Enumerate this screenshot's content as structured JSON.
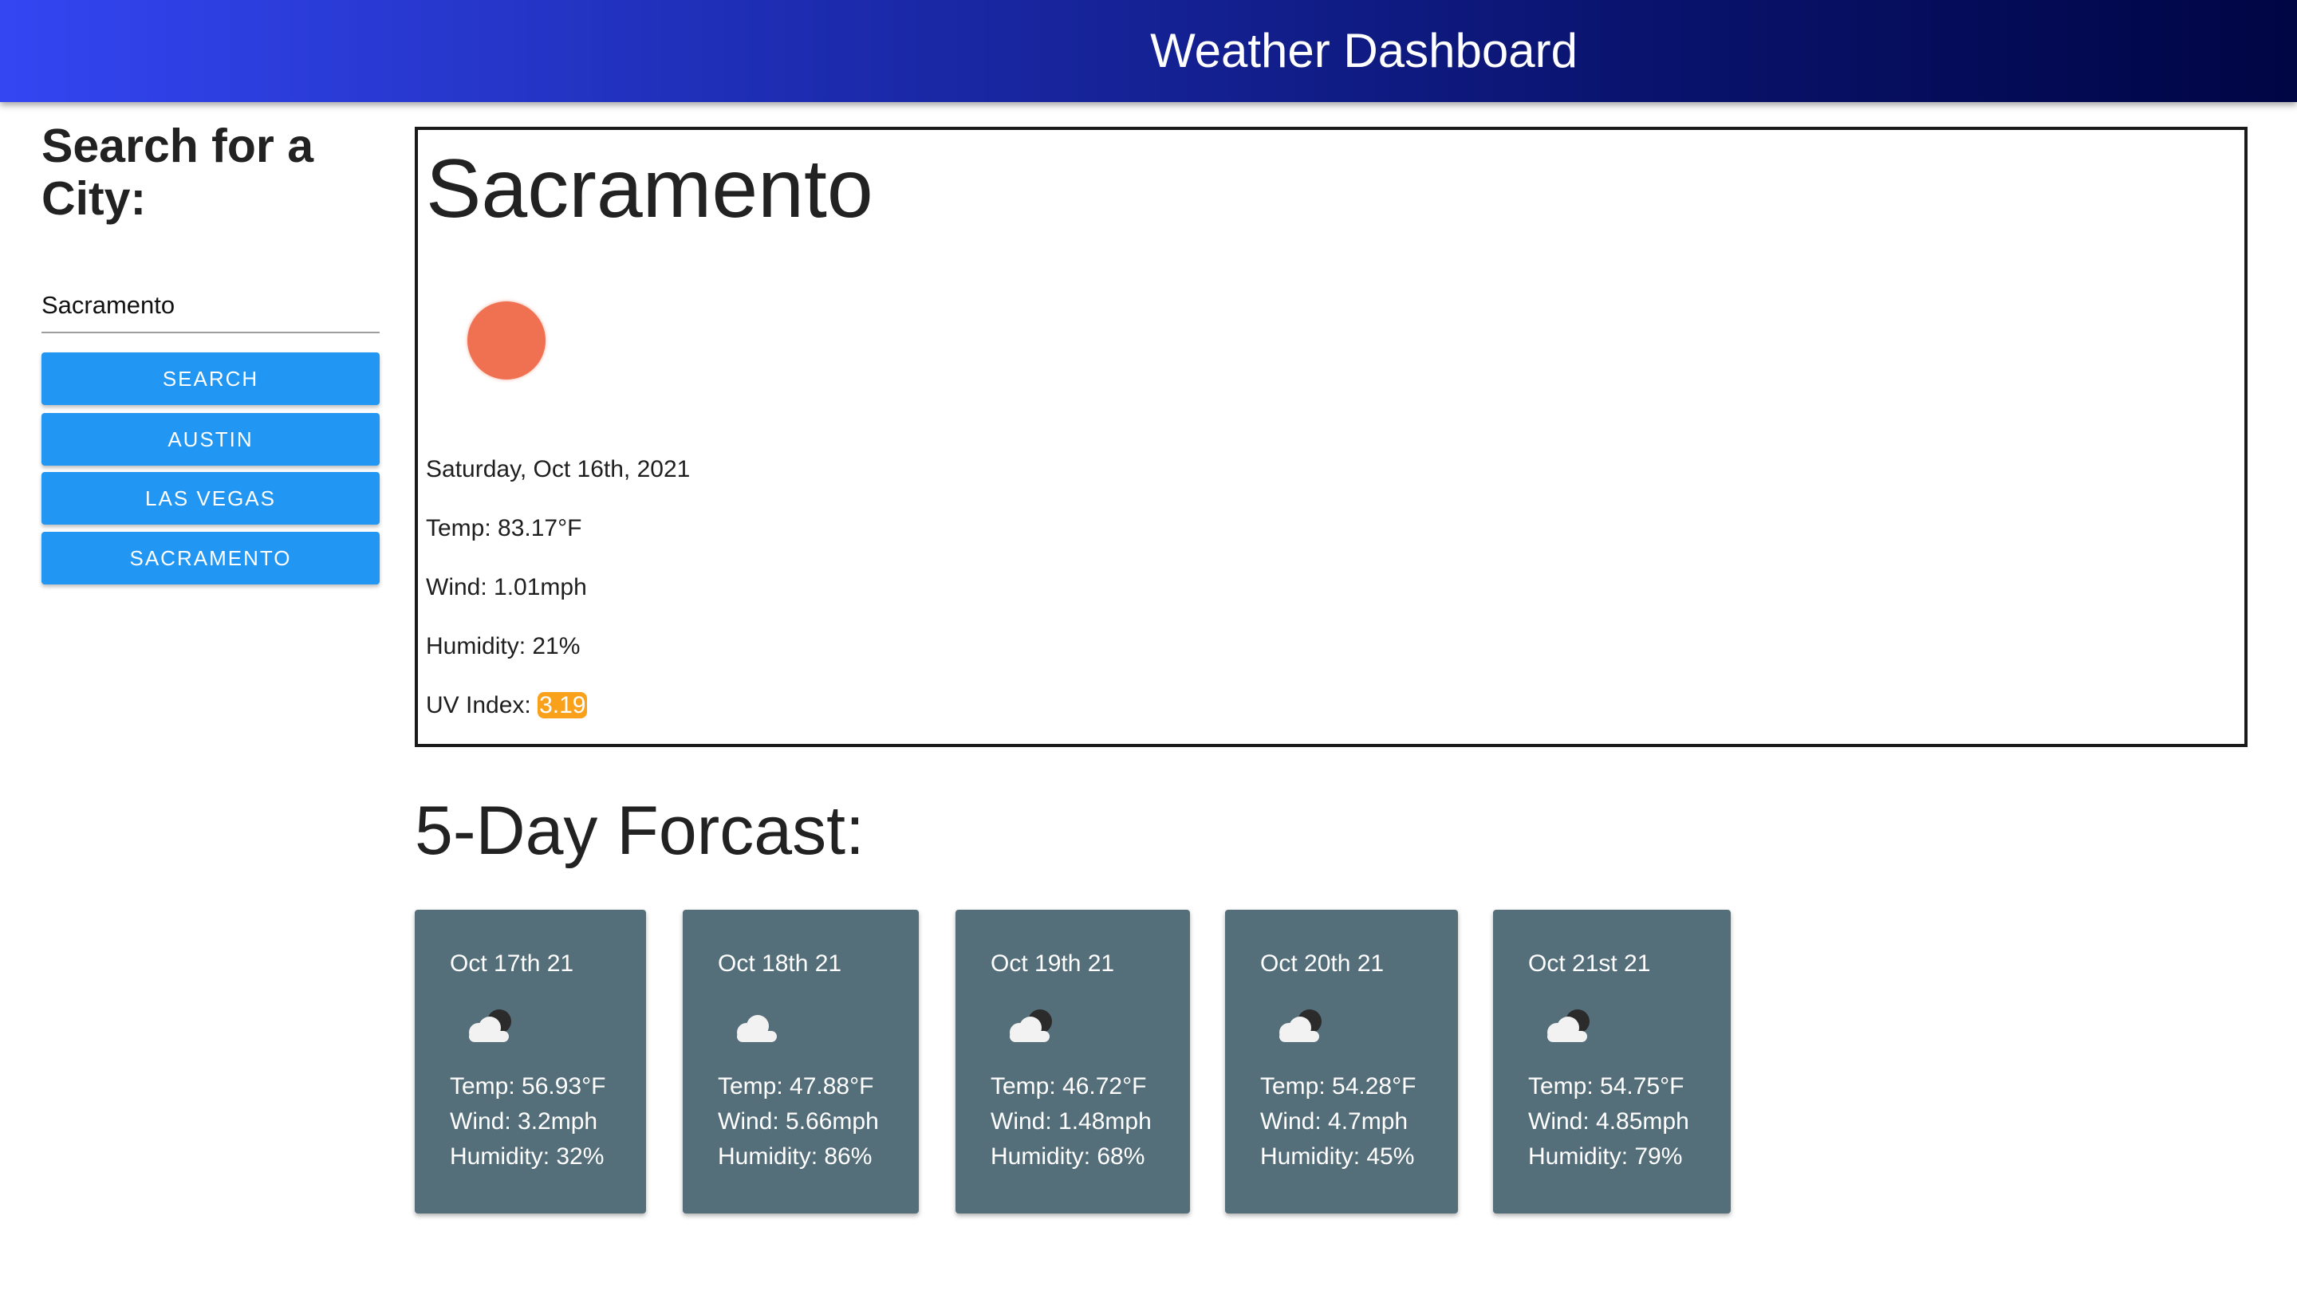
{
  "header": {
    "title": "Weather Dashboard",
    "gradient_start": "#3346f2",
    "gradient_end": "#000544"
  },
  "sidebar": {
    "heading": "Search for a City:",
    "input_value": "Sacramento",
    "search_button": "SEARCH",
    "history": [
      "AUSTIN",
      "LAS VEGAS",
      "SACRAMENTO"
    ],
    "button_color": "#2196f3"
  },
  "current": {
    "city": "Sacramento",
    "icon": "sun-icon",
    "date": "Saturday, Oct 16th, 2021",
    "temp": "Temp: 83.17°F",
    "wind": "Wind: 1.01mph",
    "humidity": "Humidity: 21%",
    "uv_label": "UV Index: ",
    "uv_value": "3.19",
    "uv_color": "#f9a11b"
  },
  "forecast": {
    "heading": "5-Day Forcast:",
    "card_color": "#546e7a",
    "days": [
      {
        "date": "Oct 17th 21",
        "icon": "cloud-moon-icon",
        "temp": "Temp: 56.93°F",
        "wind": "Wind: 3.2mph",
        "humidity": "Humidity: 32%"
      },
      {
        "date": "Oct 18th 21",
        "icon": "cloud-icon",
        "temp": "Temp: 47.88°F",
        "wind": "Wind: 5.66mph",
        "humidity": "Humidity: 86%"
      },
      {
        "date": "Oct 19th 21",
        "icon": "cloud-moon-icon",
        "temp": "Temp: 46.72°F",
        "wind": "Wind: 1.48mph",
        "humidity": "Humidity: 68%"
      },
      {
        "date": "Oct 20th 21",
        "icon": "cloud-moon-icon",
        "temp": "Temp: 54.28°F",
        "wind": "Wind: 4.7mph",
        "humidity": "Humidity: 45%"
      },
      {
        "date": "Oct 21st 21",
        "icon": "cloud-moon-icon",
        "temp": "Temp: 54.75°F",
        "wind": "Wind: 4.85mph",
        "humidity": "Humidity: 79%"
      }
    ]
  }
}
